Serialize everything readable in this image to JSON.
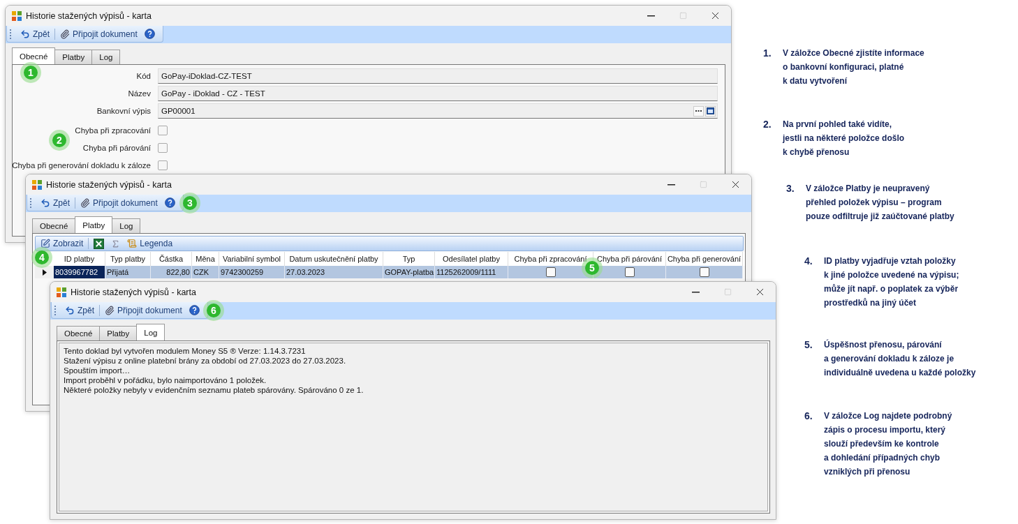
{
  "windows": [
    {
      "title": "Historie stažených výpisů - karta",
      "toolbar": [
        {
          "kind": "back",
          "label": "Zpět"
        },
        {
          "kind": "attach",
          "label": "Připojit dokument"
        },
        {
          "kind": "help"
        }
      ],
      "tabs": [
        {
          "label": "Obecné",
          "selected": true
        },
        {
          "label": "Platby",
          "selected": false
        },
        {
          "label": "Log",
          "selected": false
        }
      ],
      "content": {
        "kind": "general",
        "fields": [
          {
            "kind": "text",
            "label": "Kód",
            "value": "GoPay-iDoklad-CZ-TEST"
          },
          {
            "kind": "text",
            "label": "Název",
            "value": "GoPay - iDoklad - CZ - TEST"
          },
          {
            "kind": "lookup",
            "label": "Bankovní výpis",
            "value": "GP00001"
          }
        ],
        "checks": [
          {
            "label": "Chyba při zpracování",
            "checked": false
          },
          {
            "label": "Chyba při párování",
            "checked": false
          },
          {
            "label": "Chyba při generování dokladu k záloze",
            "checked": false
          }
        ]
      }
    },
    {
      "title": "Historie stažených výpisů - karta",
      "toolbar": [
        {
          "kind": "back",
          "label": "Zpět"
        },
        {
          "kind": "attach",
          "label": "Připojit dokument"
        },
        {
          "kind": "help"
        }
      ],
      "tabs": [
        {
          "label": "Obecné",
          "selected": false
        },
        {
          "label": "Platby",
          "selected": true
        },
        {
          "label": "Log",
          "selected": false
        }
      ],
      "content": {
        "kind": "grid",
        "tools": [
          {
            "kind": "view",
            "label": "Zobrazit"
          },
          {
            "kind": "excel"
          },
          {
            "kind": "sum"
          },
          {
            "kind": "legend",
            "label": "Legenda"
          }
        ],
        "columns": [
          {
            "label": "ID platby",
            "kind": "text"
          },
          {
            "label": "Typ platby",
            "kind": "text"
          },
          {
            "label": "Částka",
            "kind": "number"
          },
          {
            "label": "Měna",
            "kind": "text"
          },
          {
            "label": "Variabilní symbol",
            "kind": "text"
          },
          {
            "label": "Datum uskutečnění platby",
            "kind": "text"
          },
          {
            "label": "Typ",
            "kind": "text"
          },
          {
            "label": "Odesílatel platby",
            "kind": "text"
          },
          {
            "label": "Chyba při zpracování",
            "kind": "check"
          },
          {
            "label": "Chyba při párování",
            "kind": "check"
          },
          {
            "label": "Chyba při generování",
            "kind": "check"
          }
        ],
        "rows": [
          {
            "selected": true,
            "current": true,
            "cells": [
              {
                "text": "8039967782",
                "focused": true
              },
              {
                "text": "Přijatá",
                "focused": false
              },
              {
                "text": "822,80",
                "focused": false
              },
              {
                "text": "CZK",
                "focused": false
              },
              {
                "text": "9742300259",
                "focused": false
              },
              {
                "text": "27.03.2023",
                "focused": false
              },
              {
                "text": "GOPAY-platba",
                "focused": false
              },
              {
                "text": "1125262009/1111",
                "focused": false
              },
              {
                "checked": false
              },
              {
                "checked": false
              },
              {
                "checked": false
              }
            ]
          }
        ]
      }
    },
    {
      "title": "Historie stažených výpisů - karta",
      "toolbar": [
        {
          "kind": "back",
          "label": "Zpět"
        },
        {
          "kind": "attach",
          "label": "Připojit dokument"
        },
        {
          "kind": "help"
        }
      ],
      "tabs": [
        {
          "label": "Obecné",
          "selected": false
        },
        {
          "label": "Platby",
          "selected": false
        },
        {
          "label": "Log",
          "selected": true
        }
      ],
      "content": {
        "kind": "log",
        "lines": [
          "Tento doklad byl vytvořen modulem Money S5 ® Verze: 1.14.3.7231",
          "Stažení výpisu z online platební brány za období od 27.03.2023 do 27.03.2023.",
          "Spouštím import…",
          "Import proběhl v pořádku, bylo naimportováno 1 položek.",
          "Některé položky nebyly v evidenčním seznamu plateb spárovány. Spárováno 0 ze 1."
        ]
      }
    }
  ],
  "markers": [
    {
      "label": "1"
    },
    {
      "label": "2"
    },
    {
      "label": "3"
    },
    {
      "label": "4"
    },
    {
      "label": "5"
    },
    {
      "label": "6"
    }
  ],
  "notes": [
    {
      "number": "1.",
      "lines": [
        "V záložce Obecné zjistíte informace",
        "o bankovní konfiguraci, platné",
        "k datu vytvoření"
      ]
    },
    {
      "number": "2.",
      "lines": [
        "Na první pohled také vidíte,",
        "jestli na některé položce došlo",
        "k chybě přenosu"
      ]
    },
    {
      "number": "3.",
      "lines": [
        "V záložce Platby je neupravený",
        "přehled položek výpisu – program",
        "pouze odfiltruje již zaúčtované platby"
      ]
    },
    {
      "number": "4.",
      "lines": [
        "ID platby vyjadřuje vztah položky",
        "k jiné položce uvedené na výpisu;",
        "může jít např. o poplatek za výběr",
        "prostředků na jiný účet"
      ]
    },
    {
      "number": "5.",
      "lines": [
        "Úspěšnost přenosu, párování",
        "a generování dokladu k záloze je",
        "individuálně uvedena u každé položky"
      ]
    },
    {
      "number": "6.",
      "lines": [
        "V záložce Log najdete podrobný",
        "zápis o procesu importu, který",
        "slouží především ke kontrole",
        "a dohledání případných chyb",
        "vzniklých při přenosu"
      ]
    }
  ]
}
